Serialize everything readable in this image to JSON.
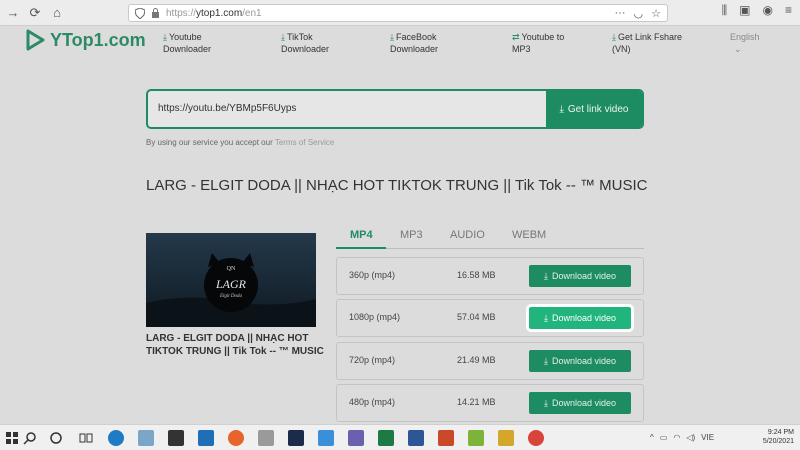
{
  "browser": {
    "url_prefix": "https://",
    "url_domain": "ytop1.com",
    "url_path": "/en1"
  },
  "site": {
    "logo": "YTop1.com",
    "nav": [
      {
        "line1": "Youtube",
        "line2": "Downloader"
      },
      {
        "line1": "TikTok",
        "line2": "Downloader"
      },
      {
        "line1": "FaceBook",
        "line2": "Downloader"
      },
      {
        "line1": "Youtube to",
        "line2": "MP3"
      },
      {
        "line1": "Get Link Fshare",
        "line2": "(VN)"
      }
    ],
    "language": "English"
  },
  "search": {
    "value": "https://youtu.be/YBMp5F6Uyps",
    "button": "Get link video"
  },
  "terms": {
    "text": "By using our service you accept our",
    "link": "Terms of Service"
  },
  "video": {
    "title": "LARG - ELGIT DODA || NHẠC HOT TIKTOK TRUNG || Tik Tok -- ™ MUSIC",
    "caption": "LARG - ELGIT DODA || NHẠC HOT TIKTOK TRUNG || Tik Tok -- ™ MUSIC",
    "thumb_top": "QN",
    "thumb_main": "LAGR",
    "thumb_sub": "Elgit Doda"
  },
  "tabs": [
    "MP4",
    "MP3",
    "AUDIO",
    "WEBM"
  ],
  "formats": [
    {
      "quality": "360p (mp4)",
      "size": "16.58 MB",
      "button": "Download video"
    },
    {
      "quality": "1080p (mp4)",
      "size": "57.04 MB",
      "button": "Download video"
    },
    {
      "quality": "720p (mp4)",
      "size": "21.49 MB",
      "button": "Download video"
    },
    {
      "quality": "480p (mp4)",
      "size": "14.21 MB",
      "button": "Download video"
    }
  ],
  "taskbar": {
    "lang": "VIE",
    "time": "9:24 PM",
    "date": "5/20/2021"
  },
  "colors": {
    "accent": "#1e8c63",
    "highlight": "#21b47c"
  }
}
